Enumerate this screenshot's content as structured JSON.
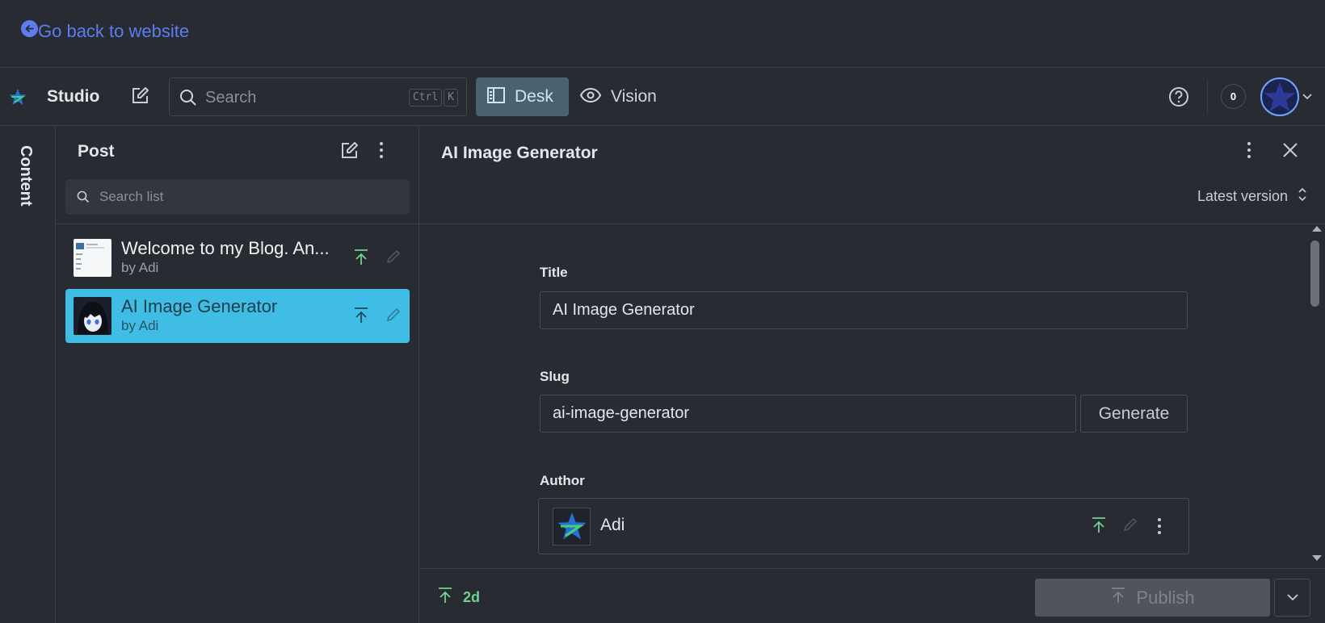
{
  "topbar": {
    "back_link": "Go back to website"
  },
  "navbar": {
    "studio_label": "Studio",
    "search_placeholder": "Search",
    "kbd_ctrl": "Ctrl",
    "kbd_k": "K",
    "desk_label": "Desk",
    "vision_label": "Vision",
    "notification_count": "0"
  },
  "rail": {
    "label": "Content"
  },
  "list": {
    "title": "Post",
    "search_placeholder": "Search list",
    "items": [
      {
        "title": "Welcome to my Blog. An...",
        "subtitle": "by Adi",
        "selected": false
      },
      {
        "title": "AI Image Generator",
        "subtitle": "by Adi",
        "selected": true
      }
    ]
  },
  "document": {
    "title": "AI Image Generator",
    "version_label": "Latest version",
    "fields": {
      "title_label": "Title",
      "title_value": "AI Image Generator",
      "slug_label": "Slug",
      "slug_value": "ai-image-generator",
      "generate_label": "Generate",
      "author_label": "Author",
      "author_name": "Adi"
    },
    "footer": {
      "status_age": "2d",
      "publish_label": "Publish"
    }
  },
  "colors": {
    "accent_link": "#5b7df0",
    "selected_item": "#3fbde5",
    "published_green": "#6fd18f",
    "desk_active": "#4a6270"
  }
}
